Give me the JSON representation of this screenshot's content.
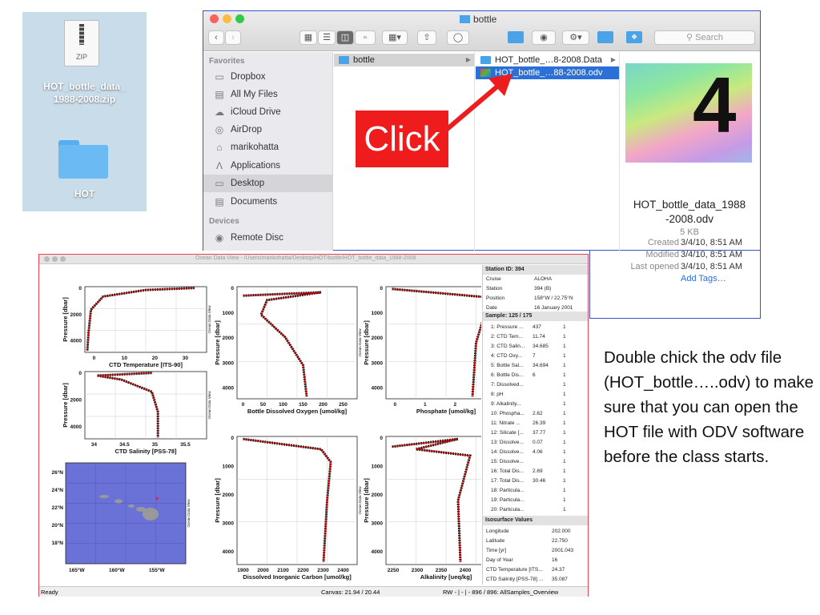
{
  "desktop": {
    "zip_icon_text": "ZIP",
    "zip_name_line1": "HOT_bottle_data_",
    "zip_name_line2": "1988-2008.zip",
    "folder_name": "HOT"
  },
  "finder": {
    "title": "bottle",
    "search_placeholder": "Search",
    "sidebar": {
      "favorites_header": "Favorites",
      "favorites": [
        {
          "label": "Dropbox",
          "icon": "folder-icon"
        },
        {
          "label": "All My Files",
          "icon": "files-icon"
        },
        {
          "label": "iCloud Drive",
          "icon": "cloud-icon"
        },
        {
          "label": "AirDrop",
          "icon": "airdrop-icon"
        },
        {
          "label": "marikohatta",
          "icon": "home-icon"
        },
        {
          "label": "Applications",
          "icon": "applications-icon"
        },
        {
          "label": "Desktop",
          "icon": "desktop-icon"
        },
        {
          "label": "Documents",
          "icon": "documents-icon"
        }
      ],
      "devices_header": "Devices",
      "devices": [
        {
          "label": "Remote Disc",
          "icon": "disc-icon"
        }
      ]
    },
    "column1": [
      "bottle"
    ],
    "column2": [
      "HOT_bottle_…8-2008.Data",
      "HOT_bottle_…88-2008.odv"
    ],
    "preview": {
      "big_number": "4",
      "name_line1": "HOT_bottle_data_1988",
      "name_line2": "-2008.odv",
      "size": "5 KB",
      "created_label": "Created",
      "created": "3/4/10, 8:51 AM",
      "modified_label": "Modified",
      "modified": "3/4/10, 8:51 AM",
      "opened_label": "Last opened",
      "opened": "3/4/10, 8:51 AM",
      "add_tags": "Add Tags…"
    }
  },
  "click_label": "Click",
  "annotation": "Double chick the odv file (HOT_bottle…..odv) to make sure that you can open the HOT file with ODV software before the class starts.",
  "odv": {
    "title": "Ocean Data View - /Users/marikohatta/Desktop/HOT/bottle/HOT_bottle_data_1988-2008",
    "watermark": "Ocean Data View",
    "plots": {
      "temp": {
        "ylabel": "Pressure [dbar]",
        "xlabel": "CTD Temperature [ITS-90]",
        "yticks": [
          "0",
          "2000",
          "4000"
        ],
        "xticks": [
          "0",
          "10",
          "20",
          "30"
        ]
      },
      "sal": {
        "ylabel": "Pressure [dbar]",
        "xlabel": "CTD Salinity [PSS-78]",
        "yticks": [
          "0",
          "2000",
          "4000"
        ],
        "xticks": [
          "34",
          "34.5",
          "35",
          "35.5"
        ]
      },
      "oxy": {
        "ylabel": "Pressure [dbar]",
        "xlabel": "Bottle Dissolved Oxygen [umol/kg]",
        "yticks": [
          "0",
          "1000",
          "2000",
          "3000",
          "4000"
        ],
        "xticks": [
          "0",
          "50",
          "100",
          "150",
          "200",
          "250"
        ]
      },
      "phos": {
        "ylabel": "Pressure [dbar]",
        "xlabel": "Phosphate [umol/kg]",
        "yticks": [
          "0",
          "1000",
          "2000",
          "3000",
          "4000"
        ],
        "xticks": [
          "0",
          "1",
          "2",
          "3"
        ]
      },
      "dic": {
        "ylabel": "Pressure [dbar]",
        "xlabel": "Dissolved Inorganic Carbon [umol/kg]",
        "yticks": [
          "0",
          "1000",
          "2000",
          "3000",
          "4000"
        ],
        "xticks": [
          "1900",
          "2000",
          "2100",
          "2200",
          "2300",
          "2400"
        ]
      },
      "alk": {
        "ylabel": "Pressure [dbar]",
        "xlabel": "Alkalinity [ueq/kg]",
        "yticks": [
          "0",
          "1000",
          "2000",
          "3000",
          "4000"
        ],
        "xticks": [
          "2250",
          "2300",
          "2350",
          "2400",
          "2450"
        ]
      },
      "map": {
        "lat": [
          "26°N",
          "24°N",
          "22°N",
          "20°N",
          "18°N"
        ],
        "lon": [
          "165°W",
          "160°W",
          "155°W"
        ]
      }
    },
    "station": {
      "header": "Station ID: 394",
      "rows": [
        [
          "Cruise",
          "ALOHA"
        ],
        [
          "Station",
          "394 (B)"
        ],
        [
          "Position",
          "158°W / 22.75°N"
        ],
        [
          "Date",
          "16 January 2001"
        ]
      ]
    },
    "sample": {
      "header": "Sample: 125 / 175",
      "rows": [
        [
          "1: Pressure ...",
          "437",
          "1"
        ],
        [
          "2: CTD Tem...",
          "11.74",
          "1"
        ],
        [
          "3: CTD Salin...",
          "34.685",
          "1"
        ],
        [
          "4: CTD Oxy...",
          "7",
          "1"
        ],
        [
          "5: Bottle Sal...",
          "34.694",
          "1"
        ],
        [
          "6: Bottle Dis...",
          "6",
          "1"
        ],
        [
          "7: Dissolved...",
          "",
          "1"
        ],
        [
          "8: pH",
          "",
          "1"
        ],
        [
          "9: Alkalinity...",
          "",
          "1"
        ],
        [
          "10: Phospha...",
          "2.62",
          "1"
        ],
        [
          "11: Nitrate ...",
          "26.39",
          "1"
        ],
        [
          "12: Silicate [...",
          "37.77",
          "1"
        ],
        [
          "13: Dissolve...",
          "0.07",
          "1"
        ],
        [
          "14: Dissolve...",
          "4.06",
          "1"
        ],
        [
          "15: Dissolve...",
          "",
          "1"
        ],
        [
          "16: Total Dis...",
          "2.69",
          "1"
        ],
        [
          "17: Total Dis...",
          "30.46",
          "1"
        ],
        [
          "18: Particula...",
          "",
          "1"
        ],
        [
          "19: Particula...",
          "",
          "1"
        ],
        [
          "20: Particula...",
          "",
          "1"
        ]
      ]
    },
    "iso": {
      "header": "Isosurface Values",
      "rows": [
        [
          "Longitude",
          "202.000"
        ],
        [
          "Latitude",
          "22.750"
        ],
        [
          "Time [yr]",
          "2001.043"
        ],
        [
          "Day of Year",
          "16"
        ],
        [
          "CTD Temperature [ITS...",
          "24.37"
        ],
        [
          "CTD Salinity [PSS-78] ...",
          "35.087"
        ]
      ]
    },
    "status": {
      "left": "Ready",
      "canvas": "Canvas:  21.94 / 20.44",
      "right": "RW - | - | -  896 / 896: AllSamples_Overview"
    }
  }
}
